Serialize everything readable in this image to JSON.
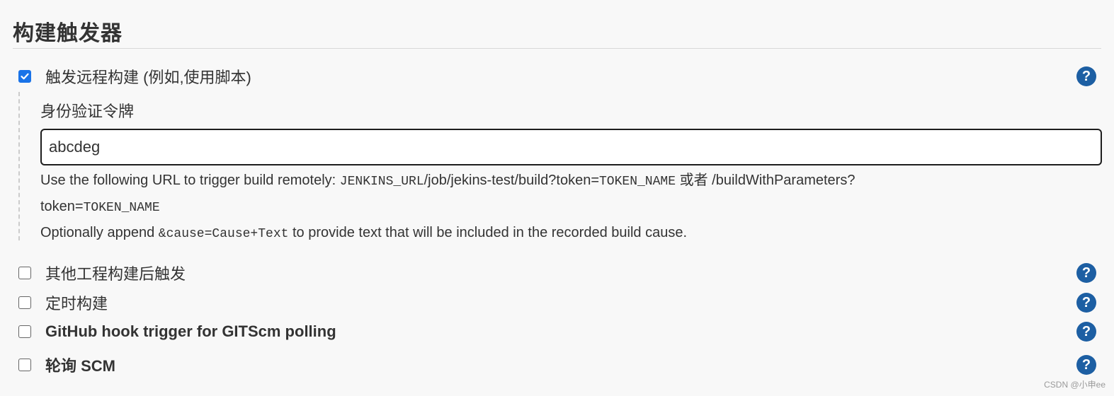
{
  "section": {
    "title": "构建触发器"
  },
  "triggers": [
    {
      "label": "触发远程构建 (例如,使用脚本)",
      "checked": true,
      "bold": false
    },
    {
      "label": "其他工程构建后触发",
      "checked": false,
      "bold": false
    },
    {
      "label": "定时构建",
      "checked": false,
      "bold": false
    },
    {
      "label": "GitHub hook trigger for GITScm polling",
      "checked": false,
      "bold": true
    },
    {
      "label": "轮询 SCM",
      "checked": false,
      "bold": true
    }
  ],
  "remote": {
    "token_label": "身份验证令牌",
    "token_value": "abcdeg",
    "help": {
      "line1_prefix": "Use the following URL to trigger build remotely: ",
      "line1_code": "JENKINS_URL",
      "line1_path": "/job/jekins-test/build?token=",
      "line1_code2": "TOKEN_NAME",
      "line1_or": " 或者 ",
      "line1_suffix": "/buildWithParameters?",
      "line2_prefix": "token=",
      "line2_code": "TOKEN_NAME",
      "line3_prefix": "Optionally append ",
      "line3_code": "&cause=Cause+Text",
      "line3_suffix": " to provide text that will be included in the recorded build cause."
    }
  },
  "help_icon_glyph": "?",
  "colors": {
    "accent": "#1a73e8",
    "help_icon": "#1d5fa3"
  },
  "watermark": "CSDN @小申ee"
}
